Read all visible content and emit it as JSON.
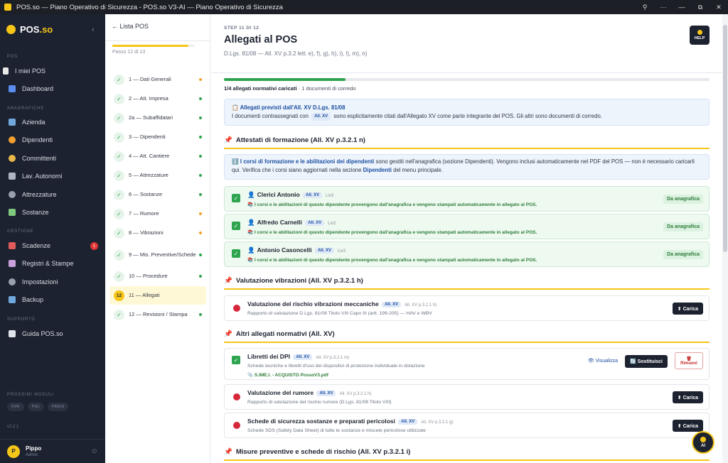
{
  "window": {
    "title": "POS.so — Piano Operativo di Sicurezza - POS.so V3-AI — Piano Operativo di Sicurezza",
    "controls": [
      "⚲",
      "···",
      "—",
      "⧉",
      "✕"
    ]
  },
  "sidebar": {
    "logo": "POS",
    "logo_suffix": ".so",
    "collapse": "‹",
    "sections": {
      "pos": "POS",
      "anagrafiche": "ANAGRAFICHE",
      "gestione": "GESTIONE",
      "supporto": "SUPPORTO",
      "moduli": "PROSSIMI MODULI"
    },
    "items": {
      "miei_pos": "I miei POS",
      "dashboard": "Dashboard",
      "azienda": "Azienda",
      "dipendenti": "Dipendenti",
      "committenti": "Committenti",
      "lav_autonomi": "Lav. Autonomi",
      "attrezzature": "Attrezzature",
      "sostanze": "Sostanze",
      "scadenze": "Scadenze",
      "scadenze_badge": "1",
      "registri": "Registri & Stampe",
      "impostazioni": "Impostazioni",
      "backup": "Backup",
      "guida": "Guida POS.so"
    },
    "modules": [
      "DVR",
      "PSC",
      "PIMUS"
    ],
    "version": "v2.2.1",
    "user": {
      "initial": "P",
      "name": "Pippo",
      "role": "Admin"
    }
  },
  "steps": {
    "back": "← Lista POS",
    "progress": 0.92,
    "counter": "Passo 12 di 13",
    "items": [
      {
        "icon": "✓",
        "label": "1 — Dati Generali",
        "dot": "#f0a030"
      },
      {
        "icon": "✓",
        "label": "2 — Att. Impresa",
        "dot": "#2ea44f"
      },
      {
        "icon": "✓",
        "label": "2a — Subaffidatari",
        "dot": "#2ea44f"
      },
      {
        "icon": "✓",
        "label": "3 — Dipendenti",
        "dot": "#2ea44f"
      },
      {
        "icon": "✓",
        "label": "4 — Att. Cantiere",
        "dot": "#2ea44f"
      },
      {
        "icon": "✓",
        "label": "5 — Attrezzature",
        "dot": "#2ea44f"
      },
      {
        "icon": "✓",
        "label": "6 — Sostanze",
        "dot": "#2ea44f"
      },
      {
        "icon": "✓",
        "label": "7 — Rumore",
        "dot": "#f0a030"
      },
      {
        "icon": "✓",
        "label": "8 — Vibrazioni",
        "dot": "#f0a030"
      },
      {
        "icon": "✓",
        "label": "9 — Mis. Preventive/Schede",
        "dot": "#2ea44f"
      },
      {
        "icon": "✓",
        "label": "10 — Procedure",
        "dot": "#2ea44f"
      },
      {
        "icon": "12",
        "label": "11 — Allegati",
        "dot": ""
      },
      {
        "icon": "✓",
        "label": "12 — Revisioni / Stampa",
        "dot": "#2ea44f"
      }
    ]
  },
  "main": {
    "step_no": "STEP 11 DI 12",
    "title": "Allegati al POS",
    "subtitle": "D.Lgs. 81/08 — All. XV p.3.2 lett. e), f), g), h), i), l), m), n)",
    "help": "HELP",
    "progress": 0.25,
    "progress_bold": "1/4 allegati normativi caricati",
    "progress_rest": " · 1 documenti di corredo",
    "info1": {
      "title": "📋 Allegati previsti dall'All. XV D.Lgs. 81/08",
      "pre": "I documenti contrassegnati con ",
      "badge": "All. XV",
      "post": " sono esplicitamente citati dall'Allegato XV come parte integrante del POS. Gli altri sono documenti di corredo."
    },
    "sec1": "Attestati di formazione (All. XV p.3.2.1 n)",
    "info2": {
      "icon": "ℹ️ ",
      "bold1": "I corsi di formazione e le abilitazioni dei dipendenti",
      "mid": " sono gestiti nell'anagrafica (sezione Dipendenti). Vengono inclusi automaticamente nel PDF del POS — non è necessario caricarli qui. Verifica che i corsi siano aggiornati nella sezione ",
      "bold2": "Dipendenti",
      "end": " del menu principale."
    },
    "employees": [
      {
        "name": "Clerici Antonio",
        "badge": "All. XV",
        "level": "Liv3",
        "note": "📚 I corsi e le abilitazioni di questo dipendente provengono dall'anagrafica e vengono stampati automaticamente in allegato al POS.",
        "tag": "Da anagrafica"
      },
      {
        "name": "Alfredo Carnelli",
        "badge": "All. XV",
        "level": "Liv2",
        "note": "📚 I corsi e le abilitazioni di questo dipendente provengono dall'anagrafica e vengono stampati automaticamente in allegato al POS.",
        "tag": "Da anagrafica"
      },
      {
        "name": "Antonio Casoncelli",
        "badge": "All. XV",
        "level": "Liv3",
        "note": "📚 I corsi e le abilitazioni di questo dipendente provengono dall'anagrafica e vengono stampati automaticamente in allegato al POS.",
        "tag": "Da anagrafica"
      }
    ],
    "sec2": "Valutazione vibrazioni (All. XV p.3.2.1 h)",
    "vib": {
      "name": "Valutazione del rischio vibrazioni meccaniche",
      "badge": "All. XV",
      "ref": "All. XV p.3.2.1 h)",
      "desc": "Rapporto di valutazione D.Lgs. 81/08 Titolo VIII Capo III (artt. 199-205) — HAV e WBV",
      "btn": "⬆ Carica"
    },
    "sec3": "Altri allegati normativi (All. XV)",
    "dpi": {
      "name": "Libretti dei DPI",
      "badge": "All. XV",
      "ref": "All. XV p.3.2.1 m)",
      "desc": "Schede tecniche e libretti d'uso dei dispositivi di protezione individuale in dotazione",
      "file": "📎 S.IME.I. - ACQUISTO PossoV3.pdf",
      "view": "👁 Visualizza",
      "replace": "🔄 Sostituisci",
      "remove_icon": "🗑",
      "remove": "Rimuovi"
    },
    "rumore": {
      "name": "Valutazione del rumore",
      "badge": "All. XV",
      "ref": "All. XV p.3.2.1 h)",
      "desc": "Rapporto di valutazione del rischio rumore (D.Lgs. 81/08 Titolo VIII)",
      "btn": "⬆ Carica"
    },
    "sds": {
      "name": "Schede di sicurezza sostanze e preparati pericolosi",
      "badge": "All. XV",
      "ref": "All. XV p.3.2.1 g)",
      "desc": "Schede SDS (Safety Data Sheet) di tutte le sostanze e miscele pericolose utilizzate",
      "btn": "⬆ Carica"
    },
    "sec4": "Misure preventive e schede di rischio (All. XV p.3.2.1 i)",
    "ai": "AI"
  },
  "colors": {
    "accent": "#f5c518",
    "dark": "#1d2230",
    "green": "#2ea44f",
    "red": "#d6283b",
    "blue": "#1b4fa0"
  }
}
